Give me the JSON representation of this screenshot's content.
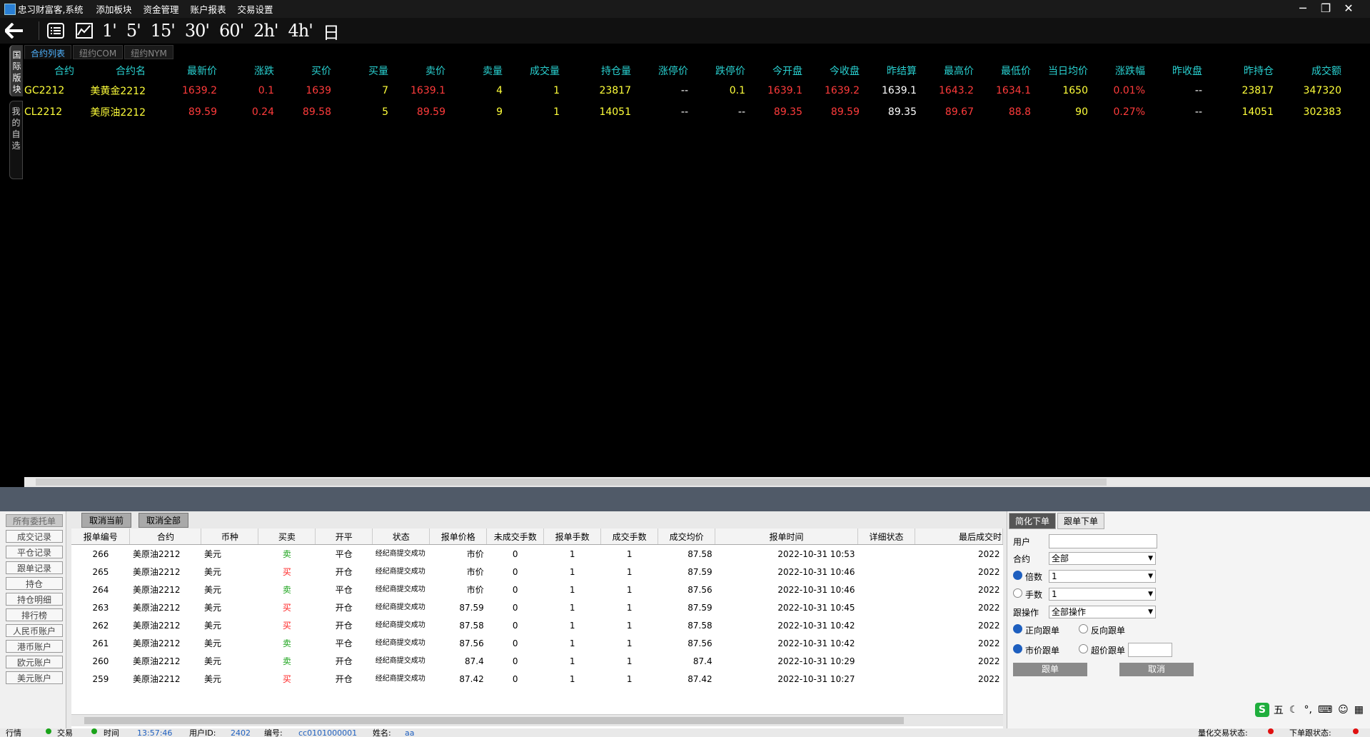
{
  "app": {
    "title": "忠习财富客,系统",
    "menu": [
      "添加板块",
      "资金管理",
      "账户报表",
      "交易设置"
    ],
    "window_controls": [
      "─",
      "❐",
      "✕"
    ]
  },
  "toolbar": {
    "periods": [
      "1'",
      "5'",
      "15'",
      "30'",
      "60'",
      "2h'",
      "4h'",
      "日"
    ]
  },
  "side_tabs": [
    {
      "label": "国际版块",
      "active": true
    },
    {
      "label": "我的自选",
      "active": false
    }
  ],
  "sub_tabs": [
    {
      "label": "合约列表",
      "active": true
    },
    {
      "label": "纽约COM",
      "active": false
    },
    {
      "label": "纽约NYM",
      "active": false
    }
  ],
  "market": {
    "columns": [
      "合约",
      "合约名",
      "最新价",
      "涨跌",
      "买价",
      "买量",
      "卖价",
      "卖量",
      "成交量",
      "持仓量",
      "涨停价",
      "跌停价",
      "今开盘",
      "今收盘",
      "昨结算",
      "最高价",
      "最低价",
      "当日均价",
      "涨跌幅",
      "昨收盘",
      "昨持仓",
      "成交额"
    ],
    "rows": [
      [
        "GC2212",
        "美黄金2212",
        "1639.2",
        "0.1",
        "1639",
        "7",
        "1639.1",
        "4",
        "1",
        "23817",
        "--",
        "0.1",
        "1639.1",
        "1639.2",
        "1639.1",
        "1643.2",
        "1634.1",
        "1650",
        "0.01%",
        "--",
        "23817",
        "347320"
      ],
      [
        "CL2212",
        "美原油2212",
        "89.59",
        "0.24",
        "89.58",
        "5",
        "89.59",
        "9",
        "1",
        "14051",
        "--",
        "--",
        "89.35",
        "89.59",
        "89.35",
        "89.67",
        "88.8",
        "90",
        "0.27%",
        "--",
        "14051",
        "302383"
      ]
    ]
  },
  "left_nav": [
    "所有委托单",
    "成交记录",
    "平仓记录",
    "跟单记录",
    "持仓",
    "持仓明细",
    "排行榜",
    "人民币账户",
    "港币账户",
    "欧元账户",
    "美元账户"
  ],
  "orders": {
    "buttons": [
      "取消当前",
      "取消全部"
    ],
    "columns": [
      "报单编号",
      "合约",
      "币种",
      "买卖",
      "开平",
      "状态",
      "报单价格",
      "未成交手数",
      "报单手数",
      "成交手数",
      "成交均价",
      "报单时间",
      "详细状态",
      "最后成交时"
    ],
    "rows": [
      [
        "266",
        "美原油2212",
        "美元",
        "卖",
        "平仓",
        "经纪商提交成功",
        "市价",
        "0",
        "1",
        "1",
        "87.58",
        "2022-10-31 10:53",
        "",
        "2022"
      ],
      [
        "265",
        "美原油2212",
        "美元",
        "买",
        "开仓",
        "经纪商提交成功",
        "市价",
        "0",
        "1",
        "1",
        "87.59",
        "2022-10-31 10:46",
        "",
        "2022"
      ],
      [
        "264",
        "美原油2212",
        "美元",
        "卖",
        "平仓",
        "经纪商提交成功",
        "市价",
        "0",
        "1",
        "1",
        "87.56",
        "2022-10-31 10:46",
        "",
        "2022"
      ],
      [
        "263",
        "美原油2212",
        "美元",
        "买",
        "开仓",
        "经纪商提交成功",
        "87.59",
        "0",
        "1",
        "1",
        "87.59",
        "2022-10-31 10:45",
        "",
        "2022"
      ],
      [
        "262",
        "美原油2212",
        "美元",
        "买",
        "开仓",
        "经纪商提交成功",
        "87.58",
        "0",
        "1",
        "1",
        "87.58",
        "2022-10-31 10:42",
        "",
        "2022"
      ],
      [
        "261",
        "美原油2212",
        "美元",
        "卖",
        "平仓",
        "经纪商提交成功",
        "87.56",
        "0",
        "1",
        "1",
        "87.56",
        "2022-10-31 10:42",
        "",
        "2022"
      ],
      [
        "260",
        "美原油2212",
        "美元",
        "卖",
        "开仓",
        "经纪商提交成功",
        "87.4",
        "0",
        "1",
        "1",
        "87.4",
        "2022-10-31 10:29",
        "",
        "2022"
      ],
      [
        "259",
        "美原油2212",
        "美元",
        "买",
        "开仓",
        "经纪商提交成功",
        "87.42",
        "0",
        "1",
        "1",
        "87.42",
        "2022-10-31 10:27",
        "",
        "2022"
      ]
    ]
  },
  "order_panel": {
    "tabs": [
      "简化下单",
      "跟单下单"
    ],
    "user_label": "用户",
    "contract_label": "合约",
    "contract_value": "全部",
    "multiple_label": "倍数",
    "multiple_value": "1",
    "lots_label": "手数",
    "lots_value": "1",
    "follow_op_label": "跟操作",
    "follow_op_value": "全部操作",
    "forward_label": "正向跟单",
    "reverse_label": "反向跟单",
    "market_label": "市价跟单",
    "overprice_label": "超价跟单",
    "follow_button": "跟单",
    "cancel_button": "取消"
  },
  "ime": {
    "label": "五"
  },
  "status_bar": {
    "market_label": "行情",
    "trade_label": "交易",
    "time_label": "时间",
    "time": "13:57:46",
    "user_id_label": "用户ID:",
    "user_id": "2402",
    "code_label": "编号:",
    "code": "cc0101000001",
    "name_label": "姓名:",
    "name": "aa",
    "quant_label": "量化交易状态:",
    "order_label": "下单跟状态:"
  },
  "colors": {
    "header": "#29d0d0",
    "up": "#ff3b3b",
    "volume": "#ffff3a",
    "buy": "#ff2020",
    "sell": "#1aa31a"
  }
}
